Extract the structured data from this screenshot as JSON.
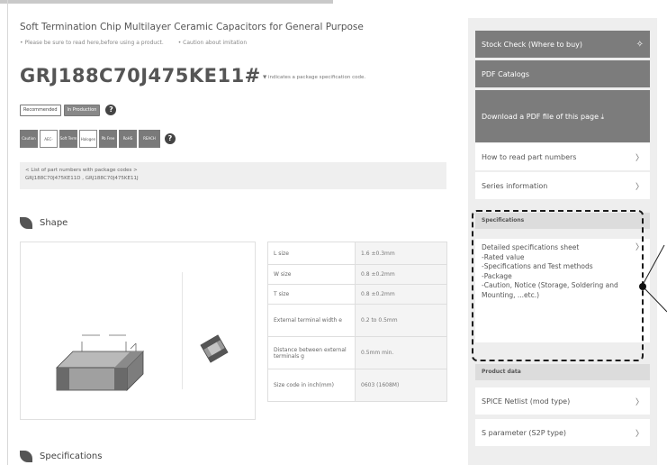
{
  "product": {
    "subtitle": "Soft Termination Chip Multilayer Ceramic Capacitors for General Purpose",
    "notes": [
      "• Please be sure to read here,before using a product.",
      "• Caution about imitation"
    ],
    "part_number": "GRJ188C70J475KE11#",
    "part_number_note": "▼ indicates a package specification code.",
    "status_badges": [
      {
        "label": "Recommended",
        "style": "light"
      },
      {
        "label": "In Production",
        "style": "dark"
      }
    ],
    "help_glyph": "?",
    "spec_icons": [
      "Caution",
      "AEC-Q200",
      "Soft Term",
      "Halogen Free",
      "Pb Free",
      "RoHS",
      "REACH"
    ],
    "codes_label": "< List of part numbers with package codes >",
    "codes": "GRJ188C70J475KE11D , GRJ188C70J475KE11J"
  },
  "sections": {
    "shape": "Shape",
    "specifications": "Specifications"
  },
  "dimensions": [
    {
      "label": "L size",
      "value": "1.6 ±0.3mm"
    },
    {
      "label": "W size",
      "value": "0.8 ±0.2mm"
    },
    {
      "label": "T size",
      "value": "0.8 ±0.2mm"
    },
    {
      "label": "External terminal width e",
      "value": "0.2 to 0.5mm"
    },
    {
      "label": "Distance between external terminals g",
      "value": "0.5mm min."
    },
    {
      "label": "Size code in inch(mm)",
      "value": "0603 (1608M)"
    }
  ],
  "sidebar": {
    "stock_check": "Stock Check (Where to buy)",
    "stock_icon": "stars-icon",
    "pdf_catalog": "PDF Catalogs",
    "download_pdf": "Download a PDF file of this page ⤓",
    "links": [
      {
        "label": "How to read part numbers",
        "chevron": "〉"
      },
      {
        "label": "Series information",
        "chevron": "〉"
      }
    ],
    "spec_header": "Specifications",
    "spec_item_title": "Detailed specifications sheet",
    "spec_item_chevron": "〉",
    "spec_item_lines": [
      "-Rated value",
      "-Specifications and Test methods",
      "-Package",
      "-Caution, Notice (Storage, Soldering and Mounting, ...etc.)"
    ],
    "product_data_header": "Product data",
    "data_links": [
      {
        "label": "SPICE Netlist (mod type)",
        "chevron": "〉"
      },
      {
        "label": "S parameter (S2P type)",
        "chevron": "〉"
      }
    ]
  },
  "colors": {
    "button_gray": "#7c7c7c",
    "sidebar_bg": "#eeeeee",
    "highlight_border": "#1a1a1a"
  }
}
